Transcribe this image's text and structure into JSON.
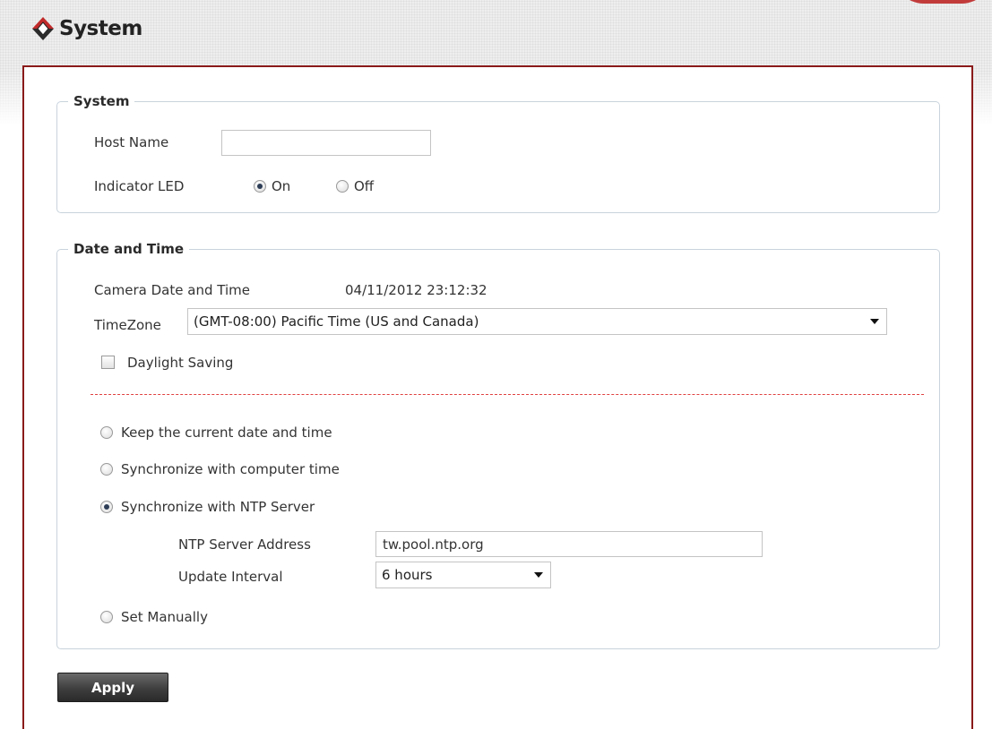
{
  "page": {
    "title": "System"
  },
  "system_section": {
    "legend": "System",
    "host_name_label": "Host Name",
    "host_name_value": "",
    "indicator_led_label": "Indicator LED",
    "led_on_label": "On",
    "led_off_label": "Off",
    "led_selected": "On"
  },
  "date_section": {
    "legend": "Date and Time",
    "camera_datetime_label": "Camera Date and Time",
    "camera_datetime_value": "04/11/2012 23:12:32",
    "timezone_label": "TimeZone",
    "timezone_value": "(GMT-08:00) Pacific Time (US and Canada)",
    "daylight_saving_label": "Daylight Saving",
    "daylight_saving_checked": false,
    "options": {
      "keep_current": "Keep the current date and time",
      "sync_computer": "Synchronize with computer time",
      "sync_ntp": "Synchronize with NTP Server",
      "set_manually": "Set Manually"
    },
    "selected_option": "Synchronize with NTP Server",
    "ntp_address_label": "NTP Server Address",
    "ntp_address_value": "tw.pool.ntp.org",
    "update_interval_label": "Update Interval",
    "update_interval_value": "6 hours"
  },
  "actions": {
    "apply_label": "Apply"
  },
  "colors": {
    "panel_border": "#8a1a1a",
    "divider": "#e04040",
    "fieldset_border": "#c9d3dc"
  }
}
